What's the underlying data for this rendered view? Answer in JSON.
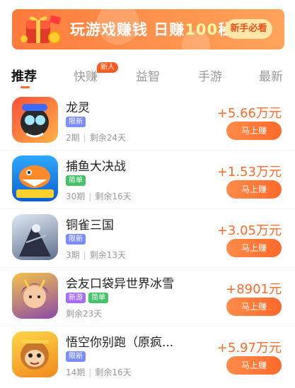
{
  "banner": {
    "text_main": "玩游戏赚钱 日赚",
    "text_accent": "100",
    "text_end": "秘籍",
    "button_label": "新手必看"
  },
  "tabs": [
    {
      "label": "推荐",
      "active": true
    },
    {
      "label": "快赚",
      "badge": "新人"
    },
    {
      "label": "益智"
    },
    {
      "label": "手游"
    },
    {
      "label": "最新"
    }
  ],
  "colors": {
    "accent": "#ff6a2b",
    "tag_limited": "#7b8cff",
    "tag_simple": "#44c36a",
    "tag_new": "#a56cff"
  },
  "games": [
    {
      "name": "龙灵",
      "tags": [
        {
          "text": "限新",
          "kind": "limited"
        }
      ],
      "periods": "2期",
      "remaining": "剩余24天",
      "reward": "+5.66万元",
      "button": "马上赚",
      "icon": "dragon-game-icon"
    },
    {
      "name": "捕鱼大决战",
      "tags": [
        {
          "text": "简单",
          "kind": "simple"
        }
      ],
      "periods": "30期",
      "remaining": "剩余16天",
      "reward": "+1.53万元",
      "button": "马上赚",
      "icon": "fish-game-icon"
    },
    {
      "name": "铜雀三国",
      "tags": [
        {
          "text": "限新",
          "kind": "limited"
        }
      ],
      "periods": "3期",
      "remaining": "剩余13天",
      "reward": "+3.05万元",
      "button": "马上赚",
      "icon": "three-kingdoms-game-icon"
    },
    {
      "name": "会友口袋异世界冰雪",
      "tags": [
        {
          "text": "新游",
          "kind": "new"
        },
        {
          "text": "简单",
          "kind": "simple"
        }
      ],
      "periods": "",
      "remaining": "剩余23天",
      "reward": "+8901元",
      "button": "马上赚",
      "icon": "pocket-world-game-icon"
    },
    {
      "name": "悟空你别跑（原疯...",
      "tags": [
        {
          "text": "限新",
          "kind": "limited"
        }
      ],
      "periods": "14期",
      "remaining": "剩余16天",
      "reward": "+5.97万元",
      "button": "马上赚",
      "icon": "wukong-game-icon"
    }
  ]
}
